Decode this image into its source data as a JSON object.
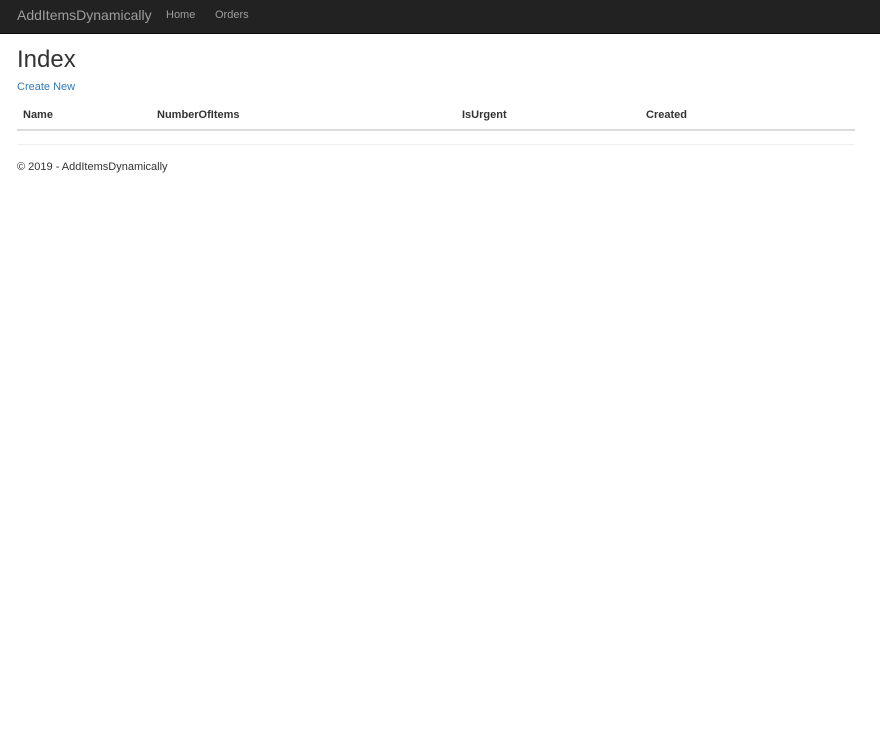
{
  "navbar": {
    "brand": "AddItemsDynamically",
    "links": [
      {
        "label": "Home"
      },
      {
        "label": "Orders"
      }
    ]
  },
  "main": {
    "title": "Index",
    "create_link": "Create New",
    "table": {
      "columns": [
        "Name",
        "NumberOfItems",
        "IsUrgent",
        "Created"
      ],
      "rows": []
    }
  },
  "footer": {
    "text": "© 2019 - AddItemsDynamically"
  }
}
